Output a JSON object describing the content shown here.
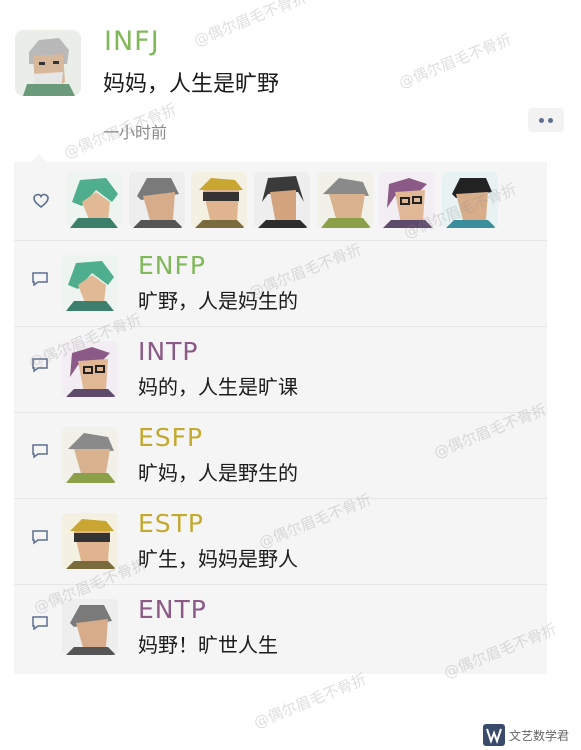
{
  "post": {
    "author": "INFJ",
    "text": "妈妈，人生是旷野",
    "time": "一小时前",
    "avatar_icon": "old-man-avatar-icon"
  },
  "likes": [
    {
      "icon": "teal-hair-avatar-icon"
    },
    {
      "icon": "gray-hair-avatar-icon"
    },
    {
      "icon": "goggles-avatar-icon"
    },
    {
      "icon": "dark-hair-avatar-icon"
    },
    {
      "icon": "gray-beanie-avatar-icon"
    },
    {
      "icon": "purple-hair-glasses-avatar-icon"
    },
    {
      "icon": "black-hair-avatar-icon"
    }
  ],
  "comments": [
    {
      "name": "ENFP",
      "text": "旷野，人是妈生的",
      "color": "#80b85a"
    },
    {
      "name": "INTP",
      "text": "妈的，人生是旷课",
      "color": "#8b5a86"
    },
    {
      "name": "ESFP",
      "text": "旷妈，人是野生的",
      "color": "#c3a92e"
    },
    {
      "name": "ESTP",
      "text": "旷生，妈妈是野人",
      "color": "#c3a92e"
    },
    {
      "name": "ENTP",
      "text": "妈野！旷世人生",
      "color": "#8b5a86"
    }
  ],
  "watermark": "@偶尔眉毛不骨折",
  "brand": "文艺数学君"
}
